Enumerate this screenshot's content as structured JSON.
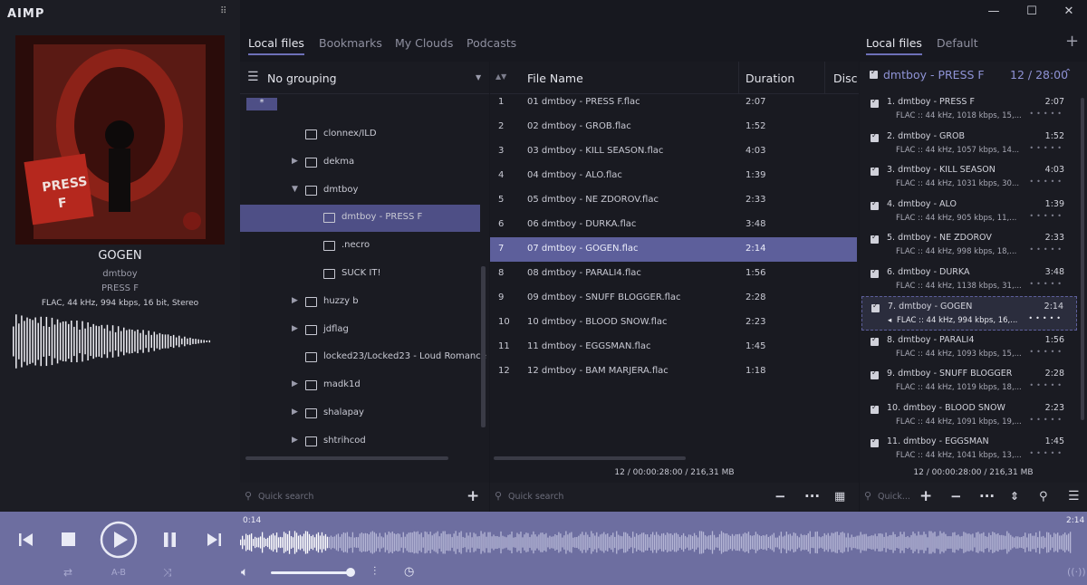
{
  "app": {
    "logo": "AIMP",
    "grid_icon": "grid-dots-icon"
  },
  "window": {
    "minimize": "—",
    "maximize": "☐",
    "close": "✕"
  },
  "now_playing": {
    "title": "GOGEN",
    "artist": "dmtboy",
    "album": "PRESS F",
    "format": "FLAC, 44 kHz, 994 kbps, 16 bit, Stereo",
    "cover_text": "PRESS F"
  },
  "left_tabs": [
    {
      "label": "Local files",
      "active": true
    },
    {
      "label": "Bookmarks",
      "active": false
    },
    {
      "label": "My Clouds",
      "active": false
    },
    {
      "label": "Podcasts",
      "active": false
    }
  ],
  "right_tabs": [
    {
      "label": "Local files",
      "active": true
    },
    {
      "label": "Default",
      "active": false
    }
  ],
  "tree": {
    "grouping_label": "No grouping",
    "star_item": "*",
    "items": [
      {
        "label": "clonnex/ILD",
        "arrow": ""
      },
      {
        "label": "dekma",
        "arrow": "▶"
      },
      {
        "label": "dmtboy",
        "arrow": "▼"
      },
      {
        "label": "dmtboy - PRESS F",
        "arrow": "",
        "selected": true
      },
      {
        "label": ".necro",
        "arrow": ""
      },
      {
        "label": "SUCK IT!",
        "arrow": ""
      },
      {
        "label": "huzzy b",
        "arrow": "▶"
      },
      {
        "label": "jdflag",
        "arrow": "▶"
      },
      {
        "label": "locked23/Locked23 - Loud Romance",
        "arrow": ""
      },
      {
        "label": "madk1d",
        "arrow": "▶"
      },
      {
        "label": "shalapay",
        "arrow": "▶"
      },
      {
        "label": "shtrihcod",
        "arrow": "▶"
      }
    ]
  },
  "files": {
    "headers": {
      "name": "File Name",
      "duration": "Duration",
      "disc": "Disc"
    },
    "rows": [
      {
        "num": "1",
        "name": "01 dmtboy - PRESS F.flac",
        "dur": "2:07"
      },
      {
        "num": "2",
        "name": "02 dmtboy - GROB.flac",
        "dur": "1:52"
      },
      {
        "num": "3",
        "name": "03 dmtboy - KILL SEASON.flac",
        "dur": "4:03"
      },
      {
        "num": "4",
        "name": "04 dmtboy - ALO.flac",
        "dur": "1:39"
      },
      {
        "num": "5",
        "name": "05 dmtboy - NE ZDOROV.flac",
        "dur": "2:33"
      },
      {
        "num": "6",
        "name": "06 dmtboy - DURKA.flac",
        "dur": "3:48"
      },
      {
        "num": "7",
        "name": "07 dmtboy - GOGEN.flac",
        "dur": "2:14",
        "selected": true
      },
      {
        "num": "8",
        "name": "08 dmtboy - PARALI4.flac",
        "dur": "1:56"
      },
      {
        "num": "9",
        "name": "09 dmtboy - SNUFF BLOGGER.flac",
        "dur": "2:28"
      },
      {
        "num": "10",
        "name": "10 dmtboy - BLOOD SNOW.flac",
        "dur": "2:23"
      },
      {
        "num": "11",
        "name": "11 dmtboy - EGGSMAN.flac",
        "dur": "1:45"
      },
      {
        "num": "12",
        "name": "12 dmtboy - BAM MARJERA.flac",
        "dur": "1:18"
      }
    ],
    "status": "12 / 00:00:28:00 / 216,31 MB"
  },
  "playlist": {
    "group_title": "dmtboy - PRESS F",
    "group_count": "12 / 28:00",
    "rows": [
      {
        "title": "1. dmtboy - PRESS F",
        "info": "FLAC :: 44 kHz, 1018 kbps, 15,...",
        "dur": "2:07"
      },
      {
        "title": "2. dmtboy - GROB",
        "info": "FLAC :: 44 kHz, 1057 kbps, 14...",
        "dur": "1:52"
      },
      {
        "title": "3. dmtboy - KILL SEASON",
        "info": "FLAC :: 44 kHz, 1031 kbps, 30...",
        "dur": "4:03"
      },
      {
        "title": "4. dmtboy - ALO",
        "info": "FLAC :: 44 kHz, 905 kbps, 11,...",
        "dur": "1:39"
      },
      {
        "title": "5. dmtboy - NE ZDOROV",
        "info": "FLAC :: 44 kHz, 998 kbps, 18,...",
        "dur": "2:33"
      },
      {
        "title": "6. dmtboy - DURKA",
        "info": "FLAC :: 44 kHz, 1138 kbps, 31,...",
        "dur": "3:48"
      },
      {
        "title": "7. dmtboy - GOGEN",
        "info": "FLAC :: 44 kHz, 994 kbps, 16,...",
        "dur": "2:14",
        "selected": true
      },
      {
        "title": "8. dmtboy - PARALI4",
        "info": "FLAC :: 44 kHz, 1093 kbps, 15,...",
        "dur": "1:56"
      },
      {
        "title": "9. dmtboy - SNUFF BLOGGER",
        "info": "FLAC :: 44 kHz, 1019 kbps, 18,...",
        "dur": "2:28"
      },
      {
        "title": "10. dmtboy - BLOOD SNOW",
        "info": "FLAC :: 44 kHz, 1091 kbps, 19,...",
        "dur": "2:23"
      },
      {
        "title": "11. dmtboy - EGGSMAN",
        "info": "FLAC :: 44 kHz, 1041 kbps, 13,...",
        "dur": "1:45"
      }
    ],
    "status": "12 / 00:00:28:00 / 216,31 MB"
  },
  "search": {
    "tree_placeholder": "Quick search",
    "files_placeholder": "Quick search",
    "playlist_placeholder": "Quick..."
  },
  "player": {
    "position": "0:14",
    "duration": "2:14",
    "ab_label": "A-B",
    "volume_fraction": 0.95,
    "progress_fraction": 0.105
  },
  "colors": {
    "accent": "#6d70b8",
    "player_bar": "#6d6ea0",
    "selection": "#5d5f9b"
  }
}
